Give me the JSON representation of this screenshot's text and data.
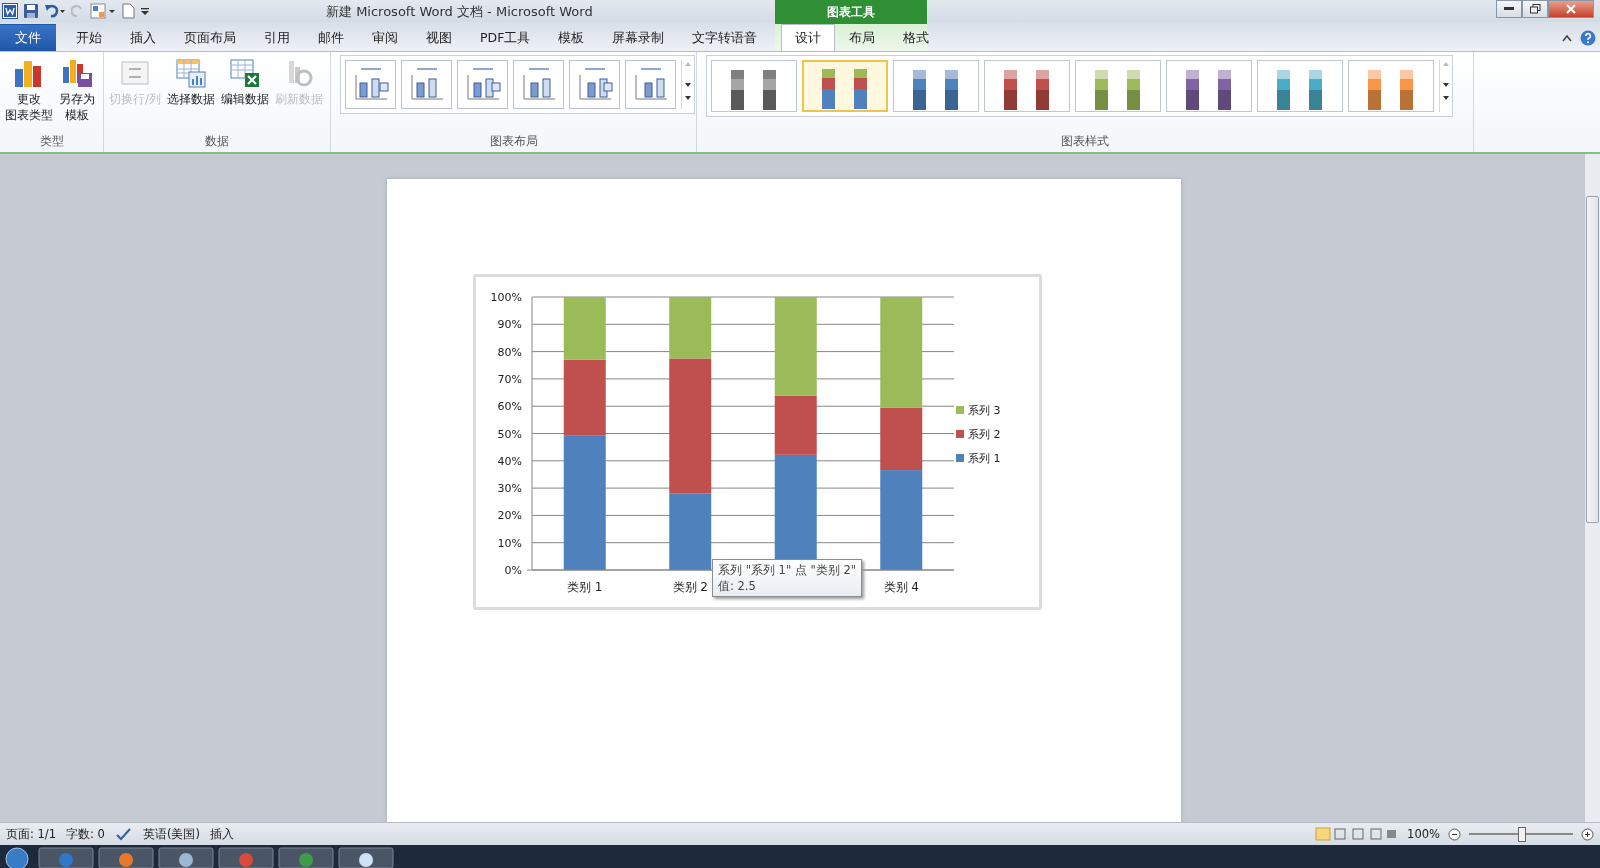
{
  "window": {
    "title": "新建 Microsoft Word 文档 - Microsoft Word",
    "context_group": "图表工具"
  },
  "tabs": [
    {
      "label": "文件",
      "kind": "file",
      "selected": false
    },
    {
      "label": "开始",
      "kind": "main",
      "selected": false
    },
    {
      "label": "插入",
      "kind": "main",
      "selected": false
    },
    {
      "label": "页面布局",
      "kind": "main",
      "selected": false
    },
    {
      "label": "引用",
      "kind": "main",
      "selected": false
    },
    {
      "label": "邮件",
      "kind": "main",
      "selected": false
    },
    {
      "label": "审阅",
      "kind": "main",
      "selected": false
    },
    {
      "label": "视图",
      "kind": "main",
      "selected": false
    },
    {
      "label": "PDF工具",
      "kind": "main",
      "selected": false
    },
    {
      "label": "模板",
      "kind": "main",
      "selected": false
    },
    {
      "label": "屏幕录制",
      "kind": "main",
      "selected": false
    },
    {
      "label": "文字转语音",
      "kind": "main",
      "selected": false
    },
    {
      "label": "设计",
      "kind": "context",
      "selected": true
    },
    {
      "label": "布局",
      "kind": "context",
      "selected": false
    },
    {
      "label": "格式",
      "kind": "context",
      "selected": false
    }
  ],
  "ribbon": {
    "type_group": {
      "label": "类型",
      "buttons": [
        {
          "lines": [
            "更改",
            "图表类型"
          ],
          "kind": "chart"
        },
        {
          "lines": [
            "另存为",
            "模板"
          ],
          "kind": "save"
        }
      ]
    },
    "data_group": {
      "label": "数据",
      "buttons": [
        {
          "label": "切换行/列",
          "kind": "switch",
          "disabled": true
        },
        {
          "label": "选择数据",
          "kind": "select",
          "disabled": false
        },
        {
          "label": "编辑数据",
          "kind": "edit",
          "disabled": false
        },
        {
          "label": "刷新数据",
          "kind": "refresh",
          "disabled": true
        }
      ]
    },
    "layout_group": {
      "label": "图表布局"
    },
    "style_group": {
      "label": "图表样式",
      "styles": [
        {
          "selected": false
        },
        {
          "selected": true
        },
        {
          "selected": false
        },
        {
          "selected": false
        },
        {
          "selected": false
        },
        {
          "selected": false
        },
        {
          "selected": false
        },
        {
          "selected": false
        }
      ]
    }
  },
  "chart": {
    "chart_data": {
      "type": "bar",
      "stacked": true,
      "grid": true,
      "legend": "right",
      "categories": [
        "类别 1",
        "类别 2",
        null,
        "类别 4"
      ],
      "series": [
        {
          "name": "系列 1",
          "color": "#4f81bd",
          "values": [
            0.494,
            0.281,
            0.422,
            0.366
          ]
        },
        {
          "name": "系列 2",
          "color": "#c0504d",
          "values": [
            0.276,
            0.494,
            0.217,
            0.228
          ]
        },
        {
          "name": "系列 3",
          "color": "#9bbb59",
          "values": [
            0.23,
            0.225,
            0.361,
            0.406
          ]
        }
      ],
      "ylim": [
        0,
        1
      ],
      "yticks": [
        {
          "value": 0,
          "label": "0%"
        },
        {
          "value": 0.1,
          "label": "10%"
        },
        {
          "value": 0.2,
          "label": "20%"
        },
        {
          "value": 0.3,
          "label": "30%"
        },
        {
          "value": 0.4,
          "label": "40%"
        },
        {
          "value": 0.5,
          "label": "50%"
        },
        {
          "value": 0.6,
          "label": "60%"
        },
        {
          "value": 0.7,
          "label": "70%"
        },
        {
          "value": 0.8,
          "label": "80%"
        },
        {
          "value": 0.9,
          "label": "90%"
        },
        {
          "value": 1,
          "label": "100%"
        }
      ]
    },
    "tooltip": [
      "系列 \"系列 1\" 点 \"类别 2\"",
      "值: 2.5"
    ]
  },
  "status_bar": {
    "items": [
      "页面: 1/1",
      "字数: 0",
      "英语(美国)",
      "插入"
    ],
    "zoom": "100%",
    "level": 0.5
  }
}
